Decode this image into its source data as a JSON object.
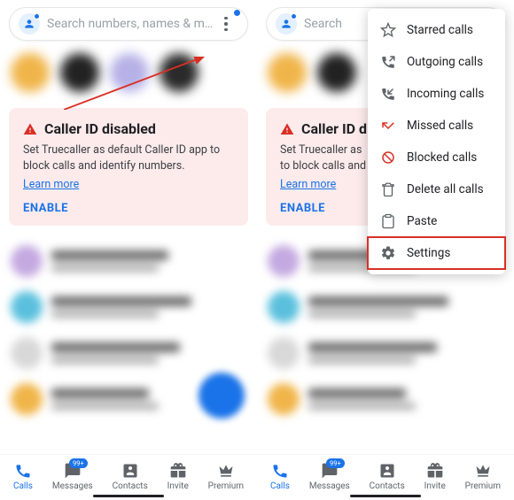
{
  "search": {
    "placeholder": "Search numbers, names & m..."
  },
  "alert": {
    "title": "Caller ID disabled",
    "body": "Set Truecaller as default Caller ID app to block calls and identify numbers.",
    "learn_more": "Learn more",
    "enable": "ENABLE"
  },
  "alert_truncated": {
    "title": "Caller ID d",
    "body1": "Set Truecaller as",
    "body2": "to block calls and",
    "learn_more": "Learn more",
    "enable": "ENABLE"
  },
  "nav": {
    "calls": "Calls",
    "messages": "Messages",
    "messages_badge": "99+",
    "contacts": "Contacts",
    "invite": "Invite",
    "premium": "Premium"
  },
  "menu": {
    "starred": "Starred calls",
    "outgoing": "Outgoing calls",
    "incoming": "Incoming calls",
    "missed": "Missed calls",
    "blocked": "Blocked calls",
    "delete_all": "Delete all calls",
    "paste": "Paste",
    "settings": "Settings"
  }
}
